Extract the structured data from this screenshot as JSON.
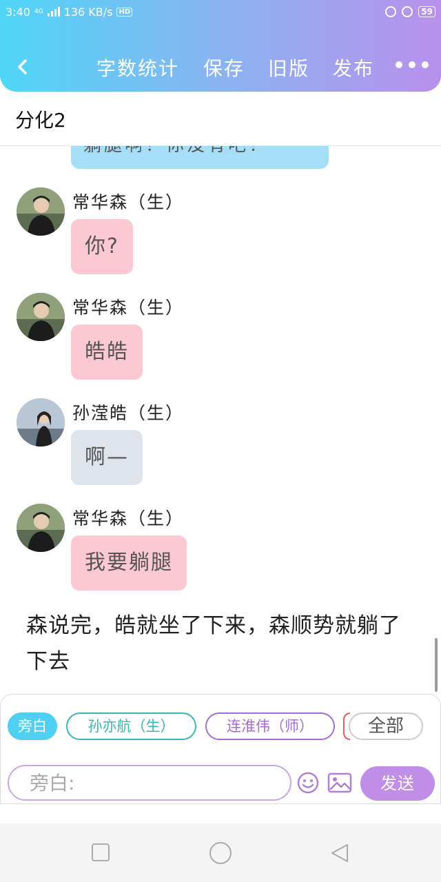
{
  "status_bar": {
    "time": "3:40",
    "network": "4G",
    "speed": "136 KB/s",
    "hd": "HD",
    "battery": "59"
  },
  "toolbar": {
    "back_icon": "chevron-left-icon",
    "word_count": "字数统计",
    "save": "保存",
    "old_version": "旧版",
    "publish": "发布",
    "more_icon": "more-dots-icon"
  },
  "doc_title": "分化2",
  "partial_bubble_text": "躺腿啊？你没有吧！",
  "messages": [
    {
      "sender": "常华森（生）",
      "text": "你?",
      "color": "#fbc8d4",
      "avatar": "avatar-chang-huasen"
    },
    {
      "sender": "常华森（生）",
      "text": "皓皓",
      "color": "#fbc8d4",
      "avatar": "avatar-chang-huasen"
    },
    {
      "sender": "孙滢皓（生）",
      "text": "啊—",
      "color": "#dfe3ec",
      "avatar": "avatar-sun-yinghao"
    },
    {
      "sender": "常华森（生）",
      "text": "我要躺腿",
      "color": "#fbc8d4",
      "avatar": "avatar-chang-huasen"
    }
  ],
  "narration": "森说完，皓就坐了下来，森顺势就躺了下去",
  "role_chips": {
    "active": "旁白",
    "chip1": "孙亦航（生）",
    "chip2": "连淮伟（师）",
    "all": "全部"
  },
  "input": {
    "placeholder": "旁白:",
    "send": "发送"
  },
  "colors": {
    "header_start": "#4fd6f7",
    "header_end": "#b990ec",
    "pink_bubble": "#fbc8d4",
    "grey_bubble": "#dfe3ec",
    "blue_bubble": "#a6def7",
    "send_button": "#c08ee6"
  }
}
